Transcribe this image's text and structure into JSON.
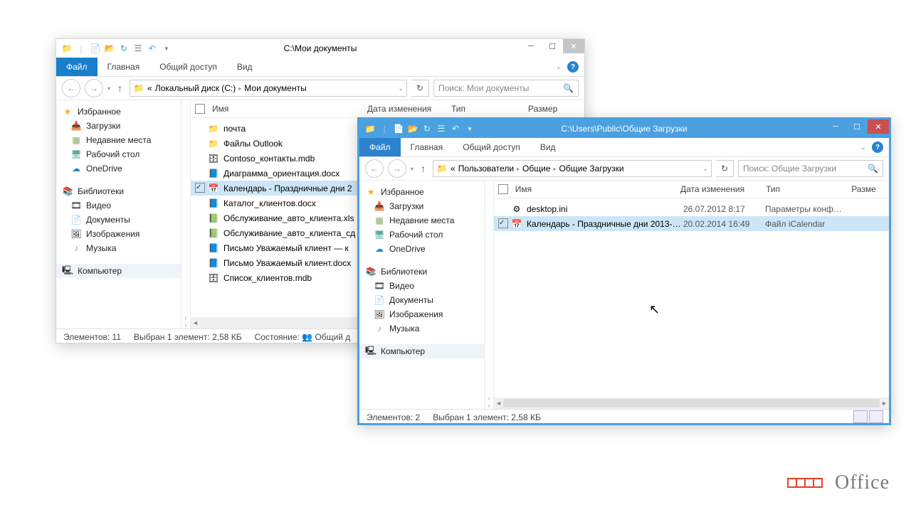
{
  "w1": {
    "title": "C:\\Мои документы",
    "tabs": [
      "Файл",
      "Главная",
      "Общий доступ",
      "Вид"
    ],
    "crumbs": [
      "«",
      "Локальный диск (C:)",
      "Мои документы"
    ],
    "search_ph": "Поиск: Мои документы",
    "cols": {
      "name": "Имя",
      "date": "Дата изменения",
      "type": "Тип",
      "size": "Размер"
    },
    "nav": {
      "fav": "Избранное",
      "dl": "Загрузки",
      "recent": "Недавние места",
      "desk": "Рабочий стол",
      "od": "OneDrive",
      "lib": "Библиотеки",
      "vid": "Видео",
      "doc": "Документы",
      "img": "Изображения",
      "mus": "Музыка",
      "comp": "Компьютер"
    },
    "files": [
      {
        "n": "почта",
        "t": "folder"
      },
      {
        "n": "Файлы Outlook",
        "t": "folder"
      },
      {
        "n": "Contoso_контакты.mdb",
        "t": "mdb"
      },
      {
        "n": "Диаграмма_ориентация.docx",
        "t": "docx"
      },
      {
        "n": "Календарь - Праздничные дни 2",
        "t": "ics",
        "sel": true,
        "chk": true
      },
      {
        "n": "Каталог_клиентов.docx",
        "t": "docx"
      },
      {
        "n": "Обслуживание_авто_клиента.xls",
        "t": "xls"
      },
      {
        "n": "Обслуживание_авто_клиента_сд",
        "t": "xls"
      },
      {
        "n": "Письмо Уважаемый клиент — к",
        "t": "docx"
      },
      {
        "n": "Письмо Уважаемый клиент.docx",
        "t": "docx"
      },
      {
        "n": "Список_клиентов.mdb",
        "t": "mdb"
      }
    ],
    "status": {
      "items": "Элементов: 11",
      "sel": "Выбран 1 элемент: 2,58 КБ",
      "state": "Состояние:",
      "share": "Общий д"
    }
  },
  "w2": {
    "title": "C:\\Users\\Public\\Общие Загрузки",
    "tabs": [
      "Файл",
      "Главная",
      "Общий доступ",
      "Вид"
    ],
    "crumbs": [
      "«",
      "Пользователи",
      "Общие",
      "Общие Загрузки"
    ],
    "search_ph": "Поиск: Общие Загрузки",
    "cols": {
      "name": "Имя",
      "date": "Дата изменения",
      "type": "Тип",
      "size": "Разме"
    },
    "files": [
      {
        "n": "desktop.ini",
        "d": "26.07.2012 8:17",
        "ty": "Параметры конф…",
        "t": "ini"
      },
      {
        "n": "Календарь - Праздничные дни 2013-…",
        "d": "20.02.2014 16:49",
        "ty": "Файл iCalendar",
        "t": "ics",
        "sel": true,
        "chk": true
      }
    ],
    "status": {
      "items": "Элементов: 2",
      "sel": "Выбран 1 элемент: 2,58 КБ"
    }
  },
  "footer": "Office"
}
